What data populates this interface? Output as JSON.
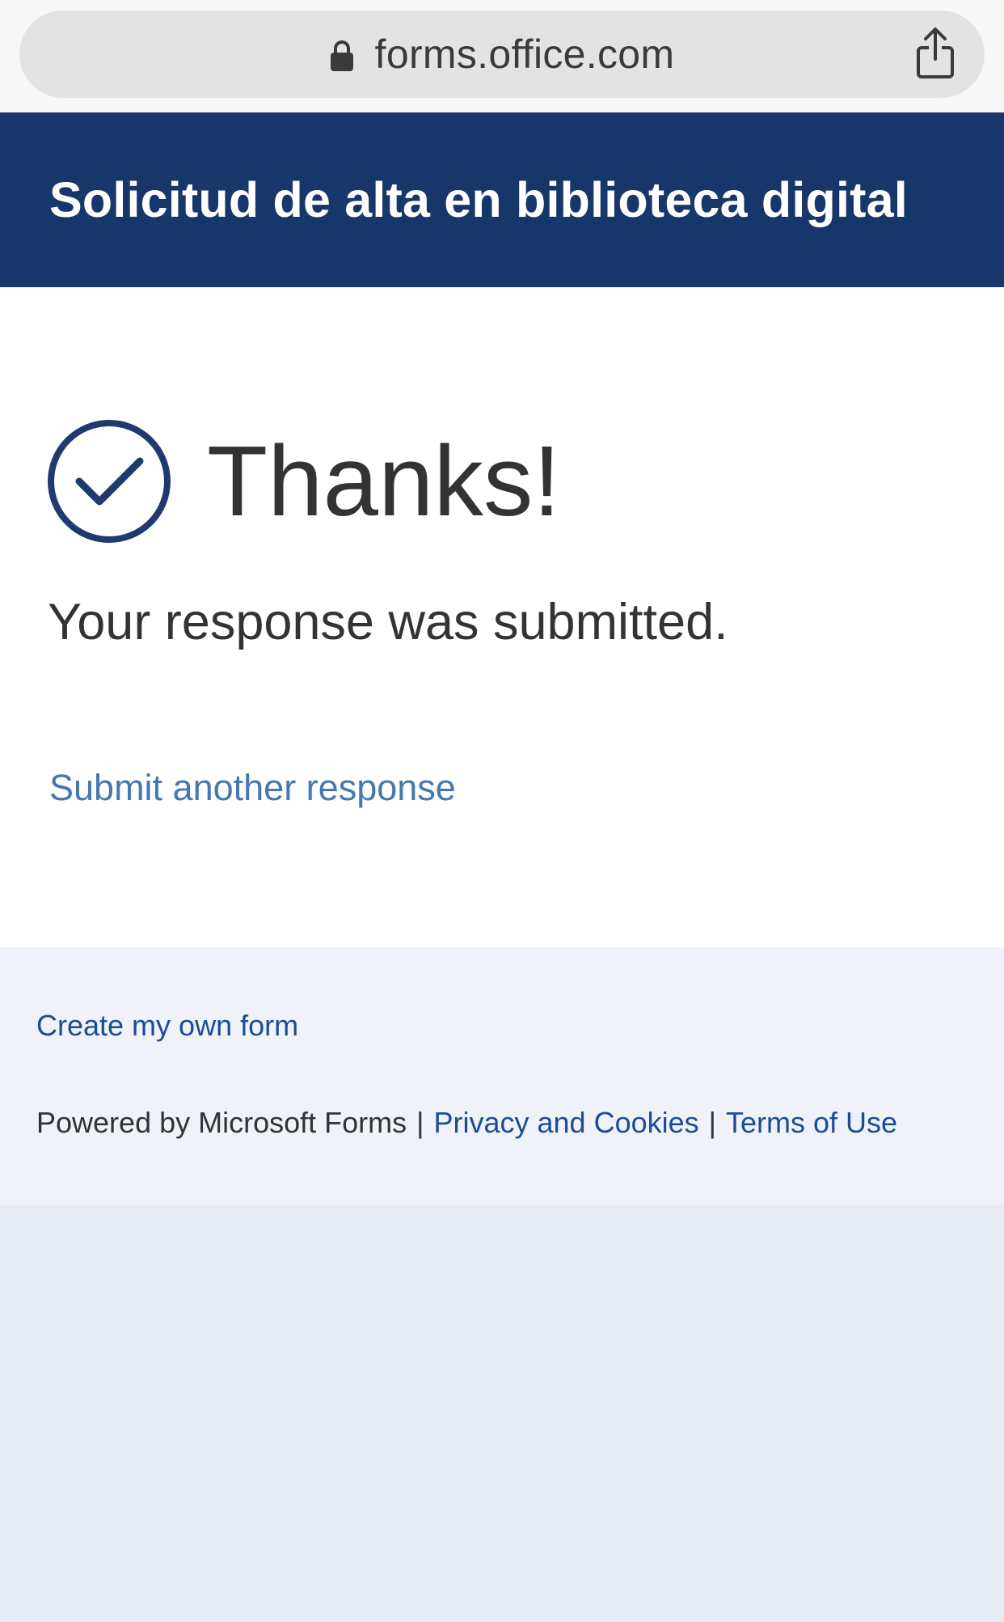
{
  "browser": {
    "url": "forms.office.com",
    "lock_icon": "lock-icon",
    "share_icon": "share-icon"
  },
  "form": {
    "title": "Solicitud de alta en biblioteca digital"
  },
  "confirmation": {
    "icon": "check-circle-icon",
    "heading": "Thanks!",
    "message": "Your response was submitted.",
    "submit_another_label": "Submit another response"
  },
  "footer": {
    "create_form_label": "Create my own form",
    "powered_by": "Powered by Microsoft Forms",
    "separator": "|",
    "privacy_label": "Privacy and Cookies",
    "terms_label": "Terms of Use"
  },
  "colors": {
    "header_bg": "#17366a",
    "check_color": "#1e3a6e",
    "link_color": "#4478b2",
    "footer_link_color": "#1b4c95",
    "footer_bg": "#eff2f8"
  }
}
